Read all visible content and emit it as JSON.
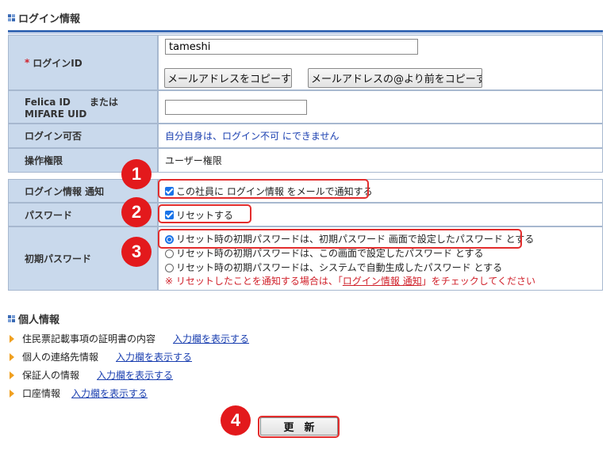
{
  "login_section": {
    "title": "ログイン情報",
    "login_id": {
      "label": "ログインID",
      "required_mark": "*",
      "value": "tameshi",
      "copy_email_button": "メールアドレスをコピーす",
      "copy_before_at_button": "メールアドレスの@より前をコピーす"
    },
    "felica": {
      "label_line1": "Felica ID　　または",
      "label_line2": "MIFARE UID",
      "value": ""
    },
    "login_allowed": {
      "label": "ログイン可否",
      "value": "自分自身は、ログイン不可  にできません"
    },
    "permission": {
      "label": "操作権限",
      "value": "ユーザー権限"
    },
    "notify": {
      "label": "ログイン情報 通知",
      "checkbox_label": "この社員に ログイン情報 をメールで通知する",
      "checked": true
    },
    "password": {
      "label": "パスワード",
      "checkbox_label": "リセットする",
      "checked": true
    },
    "initial_password": {
      "label": "初期パスワード",
      "options": [
        "リセット時の初期パスワードは、初期パスワード 画面で設定したパスワード  とする",
        "リセット時の初期パスワードは、この画面で設定したパスワード  とする",
        "リセット時の初期パスワードは、システムで自動生成したパスワード  とする"
      ],
      "selected_index": 0,
      "note_prefix": "※ リセットしたことを通知する場合は、「",
      "note_link": "ログイン情報 通知",
      "note_suffix": "」をチェックしてください"
    }
  },
  "personal_section": {
    "title": "個人情報",
    "items": [
      {
        "label": "住民票記載事項の証明書の内容",
        "link": "入力欄を表示する"
      },
      {
        "label": "個人の連絡先情報",
        "link": "入力欄を表示する"
      },
      {
        "label": "保証人の情報",
        "link": "入力欄を表示する"
      },
      {
        "label": "口座情報",
        "link": "入力欄を表示する"
      }
    ]
  },
  "update_button": "更　新",
  "badges": [
    "1",
    "2",
    "3",
    "4"
  ],
  "colors": {
    "accent": "#3b6bb5",
    "label_bg": "#c9d9ec",
    "highlight": "#e32d2d",
    "link": "#1a3fb0"
  }
}
